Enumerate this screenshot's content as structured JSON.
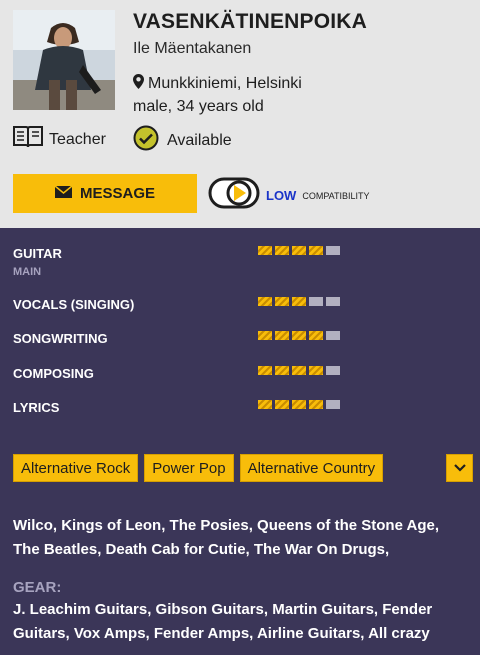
{
  "profile": {
    "username": "VASENKÄTINENPOIKA",
    "real_name": "Ile Mäentakanen",
    "location": "Munkkiniemi, Helsinki",
    "age_gender": "male, 34 years old",
    "teacher_label": "Teacher",
    "available_label": "Available"
  },
  "actions": {
    "message_label": "MESSAGE",
    "compat_level": "LOW",
    "compat_word": "COMPATIBILITY"
  },
  "skills": [
    {
      "name": "GUITAR",
      "sub": "MAIN",
      "level": 4,
      "max": 5
    },
    {
      "name": "VOCALS (SINGING)",
      "level": 3,
      "max": 5
    },
    {
      "name": "SONGWRITING",
      "level": 4,
      "max": 5
    },
    {
      "name": "COMPOSING",
      "level": 4,
      "max": 5
    },
    {
      "name": "LYRICS",
      "level": 4,
      "max": 5
    }
  ],
  "genres": [
    "Alternative Rock",
    "Power Pop",
    "Alternative Country"
  ],
  "influences": "Wilco, Kings of Leon, The Posies, Queens of the Stone Age, The Beatles, Death Cab for Cutie, The War On Drugs,",
  "gear_heading": "GEAR:",
  "gear": "J. Leachim Guitars, Gibson Guitars, Martin Guitars, Fender Guitars, Vox Amps, Fender Amps, Airline Guitars, All crazy",
  "colors": {
    "accent": "#f8bd0a",
    "panel": "#3b3658",
    "header_bg": "#e6e6e6",
    "low_compat": "#1a34c8"
  },
  "icons": {
    "location": "map-pin-icon",
    "teacher": "book-icon",
    "available": "check-circle-icon",
    "message": "envelope-icon",
    "compat": "play-compat-icon",
    "expand": "chevron-down-icon"
  }
}
